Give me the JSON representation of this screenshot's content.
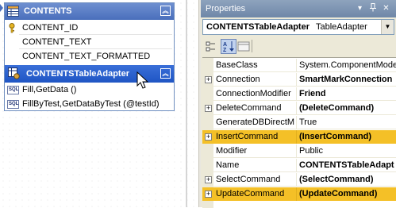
{
  "designer": {
    "table": {
      "title": "CONTENTS",
      "columns": [
        "CONTENT_ID",
        "CONTENT_TEXT",
        "CONTENT_TEXT_FORMATTED"
      ]
    },
    "adapter": {
      "title": "CONTENTSTableAdapter",
      "queries": [
        "Fill,GetData ()",
        "FillByTest,GetDataByTest (@testId)"
      ],
      "query_icon_label": "SQL"
    }
  },
  "properties": {
    "title": "Properties",
    "object_name": "CONTENTSTableAdapter",
    "object_type": "TableAdapter",
    "highlight_color": "#f4c027",
    "rows": [
      {
        "name": "BaseClass",
        "value": "System.ComponentModel",
        "bold": false,
        "expander": false,
        "highlight": false
      },
      {
        "name": "Connection",
        "value": "SmartMarkConnection",
        "bold": true,
        "expander": true,
        "highlight": false
      },
      {
        "name": "ConnectionModifier",
        "value": "Friend",
        "bold": true,
        "expander": false,
        "highlight": false
      },
      {
        "name": "DeleteCommand",
        "value": "(DeleteCommand)",
        "bold": true,
        "expander": true,
        "highlight": false
      },
      {
        "name": "GenerateDBDirectMe",
        "value": "True",
        "bold": false,
        "expander": false,
        "highlight": false
      },
      {
        "name": "InsertCommand",
        "value": "(InsertCommand)",
        "bold": true,
        "expander": true,
        "highlight": true
      },
      {
        "name": "Modifier",
        "value": "Public",
        "bold": false,
        "expander": false,
        "highlight": false
      },
      {
        "name": "Name",
        "value": "CONTENTSTableAdapt",
        "bold": true,
        "expander": false,
        "highlight": false
      },
      {
        "name": "SelectCommand",
        "value": "(SelectCommand)",
        "bold": true,
        "expander": true,
        "highlight": false
      },
      {
        "name": "UpdateCommand",
        "value": "(UpdateCommand)",
        "bold": true,
        "expander": true,
        "highlight": true
      }
    ]
  }
}
